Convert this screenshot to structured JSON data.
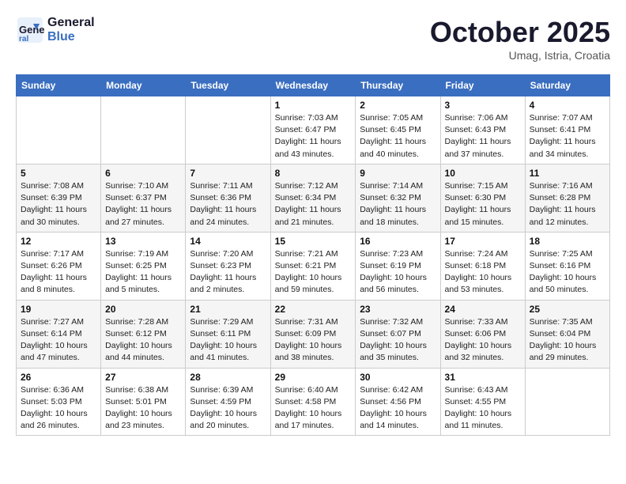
{
  "header": {
    "logo_line1": "General",
    "logo_line2": "Blue",
    "month": "October 2025",
    "location": "Umag, Istria, Croatia"
  },
  "days_of_week": [
    "Sunday",
    "Monday",
    "Tuesday",
    "Wednesday",
    "Thursday",
    "Friday",
    "Saturday"
  ],
  "weeks": [
    [
      {
        "day": "",
        "info": ""
      },
      {
        "day": "",
        "info": ""
      },
      {
        "day": "",
        "info": ""
      },
      {
        "day": "1",
        "info": "Sunrise: 7:03 AM\nSunset: 6:47 PM\nDaylight: 11 hours\nand 43 minutes."
      },
      {
        "day": "2",
        "info": "Sunrise: 7:05 AM\nSunset: 6:45 PM\nDaylight: 11 hours\nand 40 minutes."
      },
      {
        "day": "3",
        "info": "Sunrise: 7:06 AM\nSunset: 6:43 PM\nDaylight: 11 hours\nand 37 minutes."
      },
      {
        "day": "4",
        "info": "Sunrise: 7:07 AM\nSunset: 6:41 PM\nDaylight: 11 hours\nand 34 minutes."
      }
    ],
    [
      {
        "day": "5",
        "info": "Sunrise: 7:08 AM\nSunset: 6:39 PM\nDaylight: 11 hours\nand 30 minutes."
      },
      {
        "day": "6",
        "info": "Sunrise: 7:10 AM\nSunset: 6:37 PM\nDaylight: 11 hours\nand 27 minutes."
      },
      {
        "day": "7",
        "info": "Sunrise: 7:11 AM\nSunset: 6:36 PM\nDaylight: 11 hours\nand 24 minutes."
      },
      {
        "day": "8",
        "info": "Sunrise: 7:12 AM\nSunset: 6:34 PM\nDaylight: 11 hours\nand 21 minutes."
      },
      {
        "day": "9",
        "info": "Sunrise: 7:14 AM\nSunset: 6:32 PM\nDaylight: 11 hours\nand 18 minutes."
      },
      {
        "day": "10",
        "info": "Sunrise: 7:15 AM\nSunset: 6:30 PM\nDaylight: 11 hours\nand 15 minutes."
      },
      {
        "day": "11",
        "info": "Sunrise: 7:16 AM\nSunset: 6:28 PM\nDaylight: 11 hours\nand 12 minutes."
      }
    ],
    [
      {
        "day": "12",
        "info": "Sunrise: 7:17 AM\nSunset: 6:26 PM\nDaylight: 11 hours\nand 8 minutes."
      },
      {
        "day": "13",
        "info": "Sunrise: 7:19 AM\nSunset: 6:25 PM\nDaylight: 11 hours\nand 5 minutes."
      },
      {
        "day": "14",
        "info": "Sunrise: 7:20 AM\nSunset: 6:23 PM\nDaylight: 11 hours\nand 2 minutes."
      },
      {
        "day": "15",
        "info": "Sunrise: 7:21 AM\nSunset: 6:21 PM\nDaylight: 10 hours\nand 59 minutes."
      },
      {
        "day": "16",
        "info": "Sunrise: 7:23 AM\nSunset: 6:19 PM\nDaylight: 10 hours\nand 56 minutes."
      },
      {
        "day": "17",
        "info": "Sunrise: 7:24 AM\nSunset: 6:18 PM\nDaylight: 10 hours\nand 53 minutes."
      },
      {
        "day": "18",
        "info": "Sunrise: 7:25 AM\nSunset: 6:16 PM\nDaylight: 10 hours\nand 50 minutes."
      }
    ],
    [
      {
        "day": "19",
        "info": "Sunrise: 7:27 AM\nSunset: 6:14 PM\nDaylight: 10 hours\nand 47 minutes."
      },
      {
        "day": "20",
        "info": "Sunrise: 7:28 AM\nSunset: 6:12 PM\nDaylight: 10 hours\nand 44 minutes."
      },
      {
        "day": "21",
        "info": "Sunrise: 7:29 AM\nSunset: 6:11 PM\nDaylight: 10 hours\nand 41 minutes."
      },
      {
        "day": "22",
        "info": "Sunrise: 7:31 AM\nSunset: 6:09 PM\nDaylight: 10 hours\nand 38 minutes."
      },
      {
        "day": "23",
        "info": "Sunrise: 7:32 AM\nSunset: 6:07 PM\nDaylight: 10 hours\nand 35 minutes."
      },
      {
        "day": "24",
        "info": "Sunrise: 7:33 AM\nSunset: 6:06 PM\nDaylight: 10 hours\nand 32 minutes."
      },
      {
        "day": "25",
        "info": "Sunrise: 7:35 AM\nSunset: 6:04 PM\nDaylight: 10 hours\nand 29 minutes."
      }
    ],
    [
      {
        "day": "26",
        "info": "Sunrise: 6:36 AM\nSunset: 5:03 PM\nDaylight: 10 hours\nand 26 minutes."
      },
      {
        "day": "27",
        "info": "Sunrise: 6:38 AM\nSunset: 5:01 PM\nDaylight: 10 hours\nand 23 minutes."
      },
      {
        "day": "28",
        "info": "Sunrise: 6:39 AM\nSunset: 4:59 PM\nDaylight: 10 hours\nand 20 minutes."
      },
      {
        "day": "29",
        "info": "Sunrise: 6:40 AM\nSunset: 4:58 PM\nDaylight: 10 hours\nand 17 minutes."
      },
      {
        "day": "30",
        "info": "Sunrise: 6:42 AM\nSunset: 4:56 PM\nDaylight: 10 hours\nand 14 minutes."
      },
      {
        "day": "31",
        "info": "Sunrise: 6:43 AM\nSunset: 4:55 PM\nDaylight: 10 hours\nand 11 minutes."
      },
      {
        "day": "",
        "info": ""
      }
    ]
  ]
}
